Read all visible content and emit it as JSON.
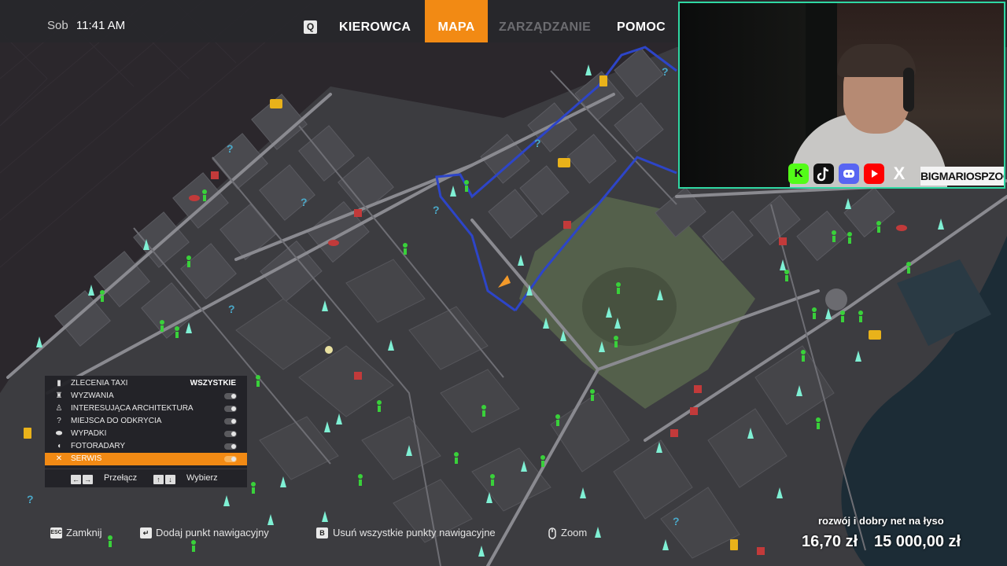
{
  "header": {
    "day": "Sob",
    "time": "11:41 AM",
    "key_hint": "Q",
    "tabs": [
      {
        "label": "KIEROWCA",
        "state": "normal"
      },
      {
        "label": "MAPA",
        "state": "active"
      },
      {
        "label": "ZARZĄDZANIE",
        "state": "disabled"
      },
      {
        "label": "POMOC",
        "state": "normal"
      }
    ]
  },
  "webcam": {
    "social_icons": [
      "kick-icon",
      "tiktok-icon",
      "discord-icon",
      "youtube-icon",
      "x-icon"
    ],
    "kick_glyph": "K",
    "x_glyph": "X",
    "handle": "BIGMARIOSPZOO"
  },
  "legend": {
    "items": [
      {
        "icon": "taxi-order-icon",
        "label": "ZLECENIA TAXI",
        "value": "WSZYSTKIE"
      },
      {
        "icon": "challenge-icon",
        "label": "WYZWANIA"
      },
      {
        "icon": "architecture-icon",
        "label": "INTERESUJĄCA ARCHITEKTURA"
      },
      {
        "icon": "question-icon",
        "label": "MIEJSCA DO ODKRYCIA"
      },
      {
        "icon": "accident-icon",
        "label": "WYPADKI"
      },
      {
        "icon": "speed-camera-icon",
        "label": "FOTORADARY"
      },
      {
        "icon": "wrench-icon",
        "label": "SERWIS",
        "selected": true
      }
    ],
    "footer": {
      "switch_label": "Przełącz",
      "select_label": "Wybierz"
    }
  },
  "hints": [
    {
      "key": "ESC",
      "label": "Zamknij"
    },
    {
      "key": "↵",
      "label": "Dodaj punkt nawigacyjny"
    },
    {
      "key": "B",
      "label": "Usuń wszystkie punkty nawigacyjne"
    },
    {
      "key": "mouse",
      "label": "Zoom"
    }
  ],
  "overlay": {
    "promo": "rozwój i dobry net na łyso",
    "balance": "16,70 zł",
    "goal": "15 000,00 zł"
  },
  "colors": {
    "accent": "#f28a14",
    "route": "#2d45c8",
    "pedestrian": "#39d13a",
    "architecture": "#7ff0d4",
    "frame": "#2fd8a3"
  }
}
